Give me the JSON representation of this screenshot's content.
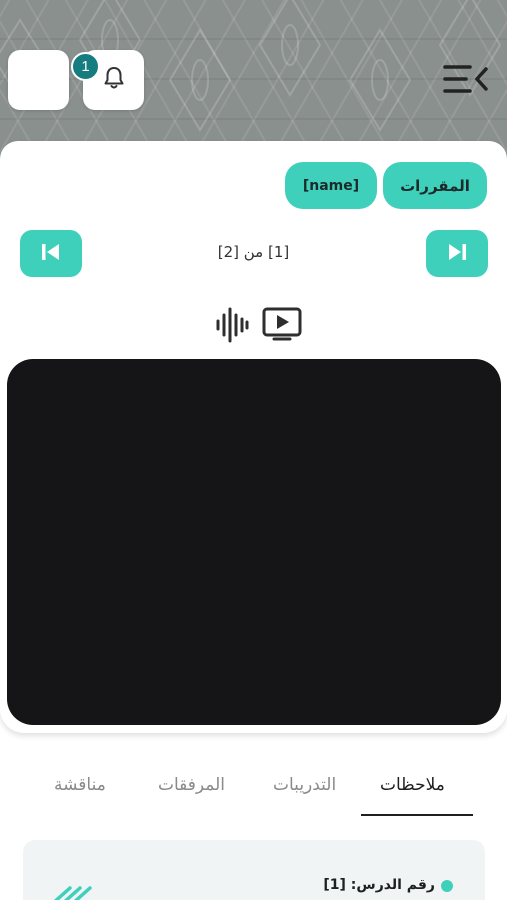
{
  "header": {
    "notification_count": "1",
    "icons": {
      "bell": "bell-icon",
      "menu": "menu-icon"
    }
  },
  "breadcrumbs": {
    "courses_label": "المقررات",
    "course_name": "[name]"
  },
  "pager": {
    "text": "[1] من [2]",
    "prev_icon": "skip-previous-icon",
    "next_icon": "skip-next-icon"
  },
  "media": {
    "audio_icon": "audio-wave-icon",
    "video_icon": "video-play-icon"
  },
  "tabs": [
    {
      "label": "ملاحظات",
      "active": true
    },
    {
      "label": "التدريبات",
      "active": false
    },
    {
      "label": "المرفقات",
      "active": false
    },
    {
      "label": "مناقشة",
      "active": false
    }
  ],
  "note": {
    "lesson_label": "رقم الدرس: [1]"
  },
  "colors": {
    "accent": "#3fd0bc",
    "badge": "#157c80",
    "video_bg": "#151517",
    "header_bg": "#8a908d"
  }
}
